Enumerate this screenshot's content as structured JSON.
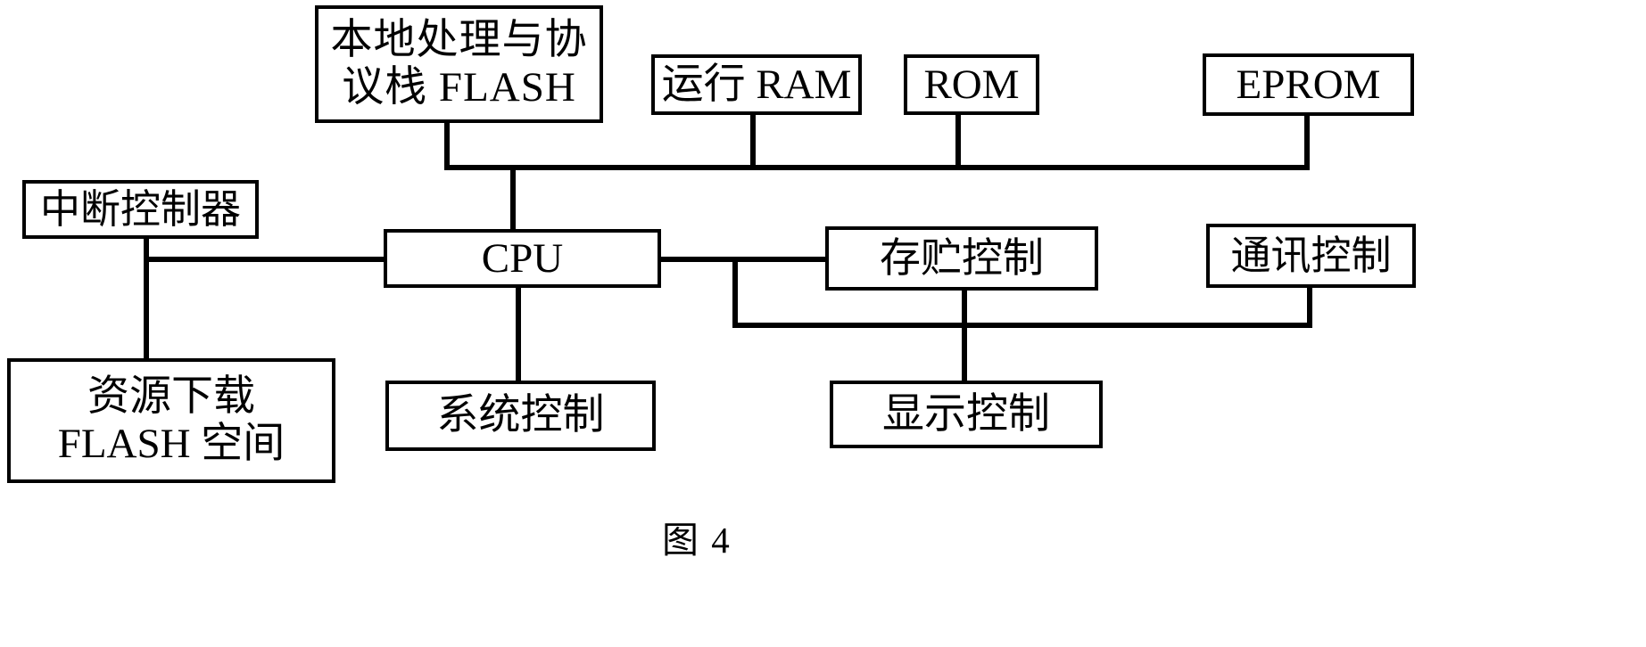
{
  "figure": {
    "caption": "图 4",
    "ink_color": "#000000",
    "background_color": "#ffffff"
  },
  "diagram": {
    "type": "block-diagram",
    "nodes": [
      {
        "id": "local_flash",
        "label_lines": [
          "本地处理与协",
          "议栈 FLASH"
        ]
      },
      {
        "id": "run_ram",
        "label_lines": [
          "运行 RAM"
        ]
      },
      {
        "id": "rom",
        "label_lines": [
          "ROM"
        ]
      },
      {
        "id": "eprom",
        "label_lines": [
          "EPROM"
        ]
      },
      {
        "id": "interrupt",
        "label_lines": [
          "中断控制器"
        ]
      },
      {
        "id": "cpu",
        "label_lines": [
          "CPU"
        ]
      },
      {
        "id": "storage_ctrl",
        "label_lines": [
          "存贮控制"
        ]
      },
      {
        "id": "comm_ctrl",
        "label_lines": [
          "通讯控制"
        ]
      },
      {
        "id": "res_flash",
        "label_lines": [
          "资源下载",
          "FLASH 空间"
        ]
      },
      {
        "id": "sys_ctrl",
        "label_lines": [
          "系统控制"
        ]
      },
      {
        "id": "disp_ctrl",
        "label_lines": [
          "显示控制"
        ]
      }
    ],
    "edges": [
      {
        "from": "local_flash",
        "to": "cpu"
      },
      {
        "from": "run_ram",
        "to": "cpu"
      },
      {
        "from": "rom",
        "to": "cpu"
      },
      {
        "from": "eprom",
        "to": "cpu"
      },
      {
        "from": "interrupt",
        "to": "cpu"
      },
      {
        "from": "interrupt",
        "to": "res_flash"
      },
      {
        "from": "cpu",
        "to": "sys_ctrl"
      },
      {
        "from": "cpu",
        "to": "storage_ctrl"
      },
      {
        "from": "cpu",
        "to": "comm_ctrl"
      },
      {
        "from": "storage_ctrl",
        "to": "disp_ctrl"
      }
    ]
  }
}
